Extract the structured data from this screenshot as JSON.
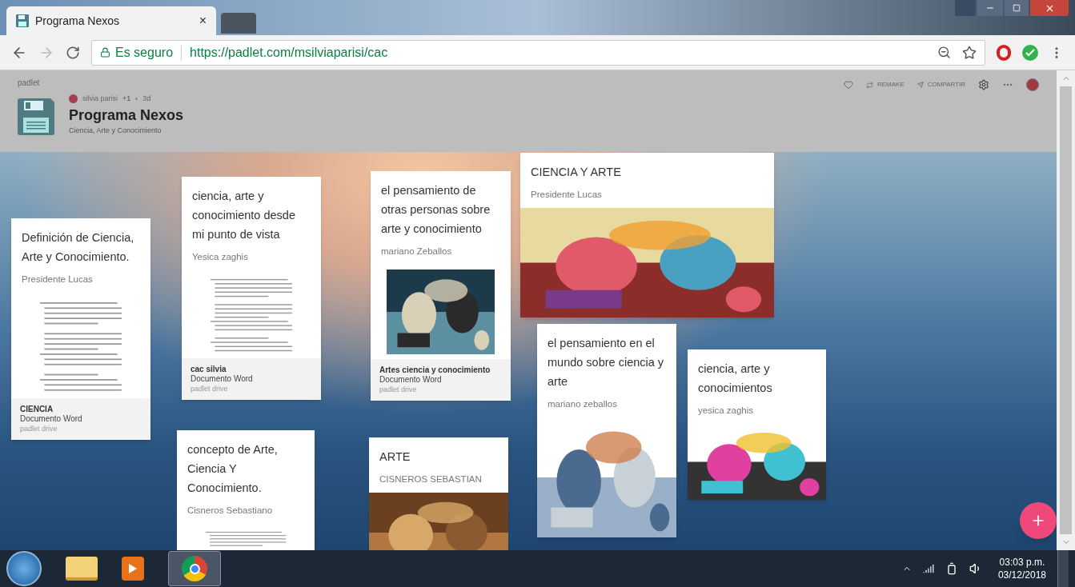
{
  "browser": {
    "tab_title": "Programa Nexos",
    "tab_close": "×",
    "security": "Es seguro",
    "url": "https://padlet.com/msilviaparisi/cac"
  },
  "header": {
    "brand": "padlet",
    "author": "silvia parisi",
    "collaborators": "+1",
    "age": "3d",
    "title": "Programa Nexos",
    "subtitle": "Ciencia, Arte y Conocimiento",
    "actions": [
      "REMAKE",
      "COMPARTIR"
    ]
  },
  "cards": [
    {
      "title": "Definición de Ciencia, Arte y Conocimiento.",
      "author": "Presidente Lucas",
      "kind": "document",
      "attachment": {
        "name": "CIENCIA",
        "type": "Documento Word",
        "source": "padlet drive"
      }
    },
    {
      "title": "ciencia, arte y conocimiento desde mi punto de vista",
      "author": "Yesica zaghis",
      "kind": "document",
      "attachment": {
        "name": "cac silvia",
        "type": "Documento Word",
        "source": "padlet drive"
      }
    },
    {
      "title": "el pensamiento de otras personas sobre arte y conocimiento",
      "author": "mariano Zeballos",
      "kind": "picture",
      "attachment": {
        "name": "Artes ciencia y conocimiento",
        "type": "Documento Word",
        "source": "padlet drive"
      }
    },
    {
      "title": "CIENCIA Y ARTE",
      "author": "Presidente Lucas",
      "kind": "picture"
    },
    {
      "title": "el pensamiento en el mundo sobre ciencia y arte",
      "author": "mariano zeballos",
      "kind": "picture"
    },
    {
      "title": "ciencia, arte y conocimientos",
      "author": "yesica zaghis",
      "kind": "picture"
    },
    {
      "title": "concepto de Arte, Ciencia Y Conocimiento.",
      "author": "Cisneros Sebastiano",
      "kind": "document"
    },
    {
      "title": "ARTE",
      "author": "CISNEROS SEBASTIAN",
      "kind": "picture"
    }
  ],
  "taskbar": {
    "time": "03:03 p.m.",
    "date": "03/12/2018"
  }
}
